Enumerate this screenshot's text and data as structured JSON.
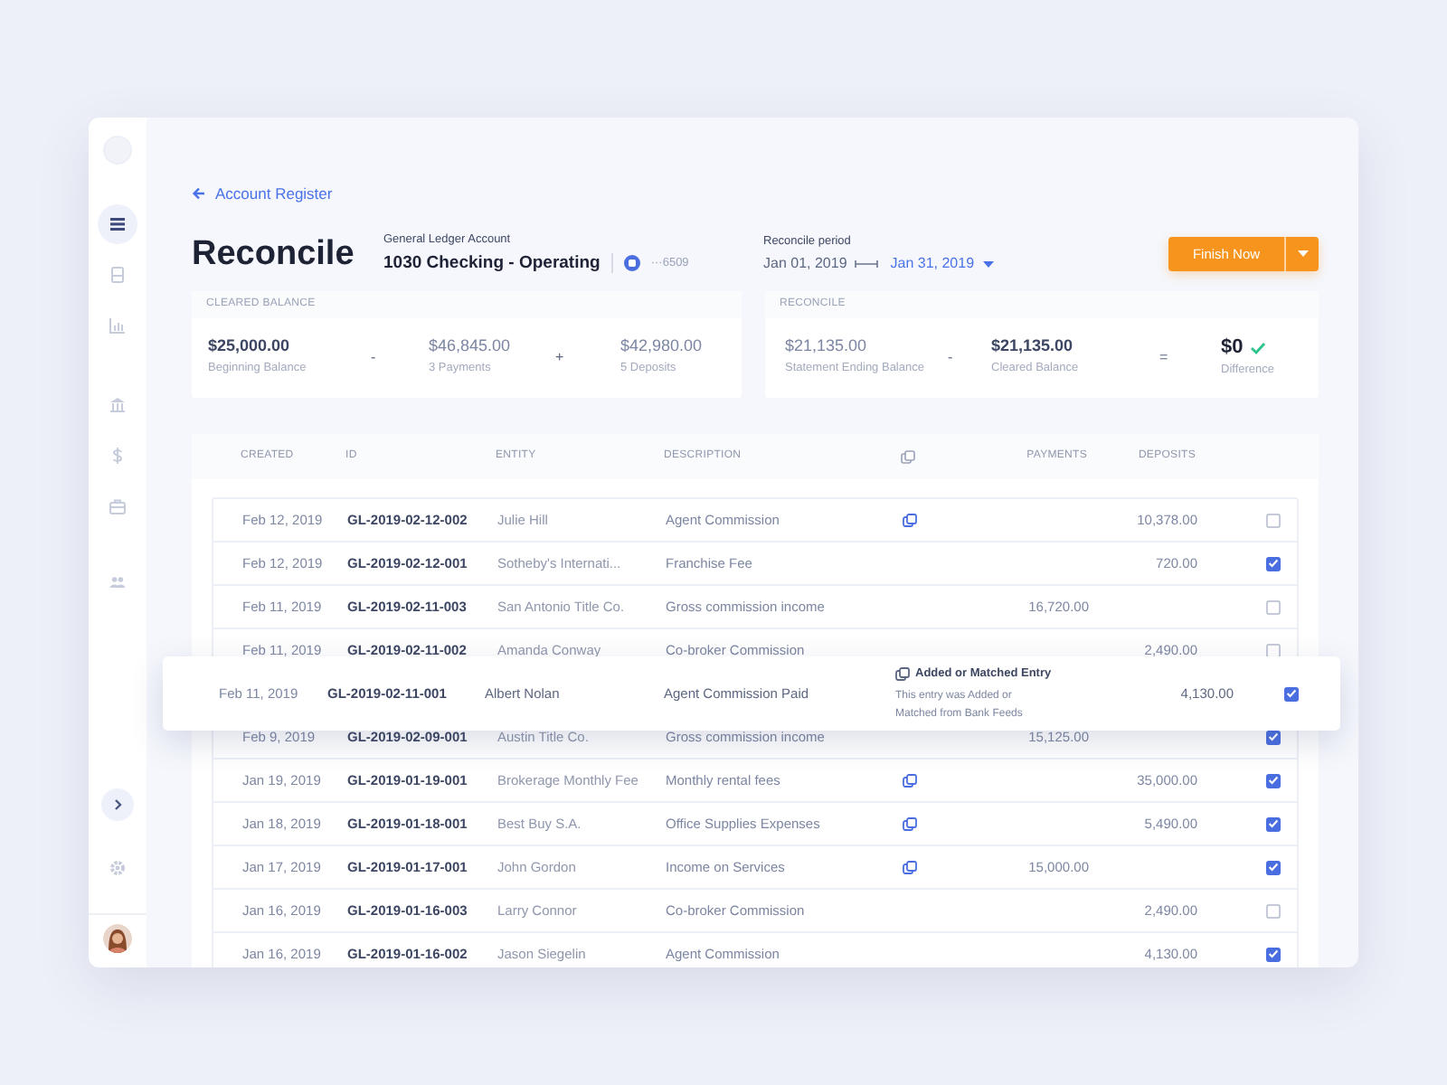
{
  "sidebar": {
    "nav": [
      {
        "selected": true
      },
      {
        "selected": false
      },
      {
        "selected": false
      },
      {
        "selected": false
      },
      {
        "selected": false
      },
      {
        "selected": false
      },
      {
        "selected": false
      }
    ]
  },
  "back_link": "Account Register",
  "page_title": "Reconcile",
  "account": {
    "label": "General Ledger Account",
    "name": "1030 Checking - Operating",
    "number": "···6509"
  },
  "period": {
    "label": "Reconcile period",
    "start": "Jan 01, 2019",
    "end": "Jan 31, 2019"
  },
  "finish_button": "Finish Now",
  "cleared_balance": {
    "title": "CLEARED BALANCE",
    "items": [
      {
        "kind": "figure",
        "amount": "$25,000.00",
        "caption": "Beginning Balance",
        "strong": true
      },
      {
        "kind": "operator",
        "symbol": "-"
      },
      {
        "kind": "figure",
        "amount": "$46,845.00",
        "caption": "3 Payments",
        "strong": false
      },
      {
        "kind": "operator",
        "symbol": "+"
      },
      {
        "kind": "figure",
        "amount": "$42,980.00",
        "caption": "5 Deposits",
        "strong": false
      }
    ]
  },
  "reconcile": {
    "title": "RECONCILE",
    "items": [
      {
        "kind": "figure",
        "amount": "$21,135.00",
        "caption": "Statement Ending Balance",
        "strong": false
      },
      {
        "kind": "operator",
        "symbol": "-"
      },
      {
        "kind": "figure",
        "amount": "$21,135.00",
        "caption": "Cleared Balance",
        "strong": true
      },
      {
        "kind": "operator",
        "symbol": "="
      },
      {
        "kind": "result",
        "amount": "$0",
        "caption": "Difference",
        "balanced": true
      }
    ]
  },
  "table": {
    "columns": [
      {
        "kind": "text",
        "label": "CREATED"
      },
      {
        "kind": "text",
        "label": "ID"
      },
      {
        "kind": "text",
        "label": "ENTITY"
      },
      {
        "kind": "text",
        "label": "DESCRIPTION"
      },
      {
        "kind": "icon"
      },
      {
        "kind": "text",
        "label": "PAYMENTS"
      },
      {
        "kind": "text",
        "label": "DEPOSITS"
      }
    ],
    "rows": [
      {
        "kind": "row",
        "created": "Feb 12, 2019",
        "id": "GL-2019-02-12-002",
        "entity": "Julie Hill",
        "description": "Agent Commission",
        "matched": true,
        "deposit": "10,378.00",
        "checked": false
      },
      {
        "kind": "row",
        "created": "Feb 12, 2019",
        "id": "GL-2019-02-12-001",
        "entity": "Sotheby's Internati...",
        "description": "Franchise Fee",
        "matched": false,
        "deposit": "720.00",
        "checked": true
      },
      {
        "kind": "row",
        "created": "Feb 11, 2019",
        "id": "GL-2019-02-11-003",
        "entity": "San Antonio Title Co.",
        "description": "Gross commission income",
        "matched": false,
        "payment": "16,720.00",
        "checked": false
      },
      {
        "kind": "row",
        "created": "Feb 11, 2019",
        "id": "GL-2019-02-11-002",
        "entity": "Amanda Conway",
        "description": "Co-broker Commission",
        "matched": false,
        "deposit": "2,490.00",
        "checked": false
      },
      {
        "kind": "floating",
        "created": "Feb 11, 2019",
        "id": "GL-2019-02-11-001",
        "entity": "Albert Nolan",
        "description": "Agent Commission Paid",
        "matched": true,
        "note_title": "Added or Matched Entry",
        "note": "This entry was Added or Matched from Bank Feeds",
        "deposit": "4,130.00",
        "checked": true
      },
      {
        "kind": "row",
        "created": "Feb 9, 2019",
        "id": "GL-2019-02-09-001",
        "entity": "Austin Title Co.",
        "description": "Gross commission income",
        "matched": false,
        "payment": "15,125.00",
        "checked": true
      },
      {
        "kind": "row",
        "created": "Jan 19, 2019",
        "id": "GL-2019-01-19-001",
        "entity": "Brokerage Monthly Fee",
        "description": "Monthly rental fees",
        "matched": true,
        "deposit": "35,000.00",
        "checked": true
      },
      {
        "kind": "row",
        "created": "Jan 18, 2019",
        "id": "GL-2019-01-18-001",
        "entity": "Best Buy S.A.",
        "description": "Office Supplies Expenses",
        "matched": true,
        "deposit": "5,490.00",
        "checked": true
      },
      {
        "kind": "row",
        "created": "Jan 17, 2019",
        "id": "GL-2019-01-17-001",
        "entity": "John Gordon",
        "description": "Income on Services",
        "matched": true,
        "payment": "15,000.00",
        "checked": true
      },
      {
        "kind": "row",
        "created": "Jan 16, 2019",
        "id": "GL-2019-01-16-003",
        "entity": "Larry Connor",
        "description": "Co-broker Commission",
        "matched": false,
        "deposit": "2,490.00",
        "checked": false
      },
      {
        "kind": "row",
        "created": "Jan 16, 2019",
        "id": "GL-2019-01-16-002",
        "entity": "Jason Siegelin",
        "description": "Agent Commission",
        "matched": false,
        "deposit": "4,130.00",
        "checked": true
      }
    ]
  }
}
